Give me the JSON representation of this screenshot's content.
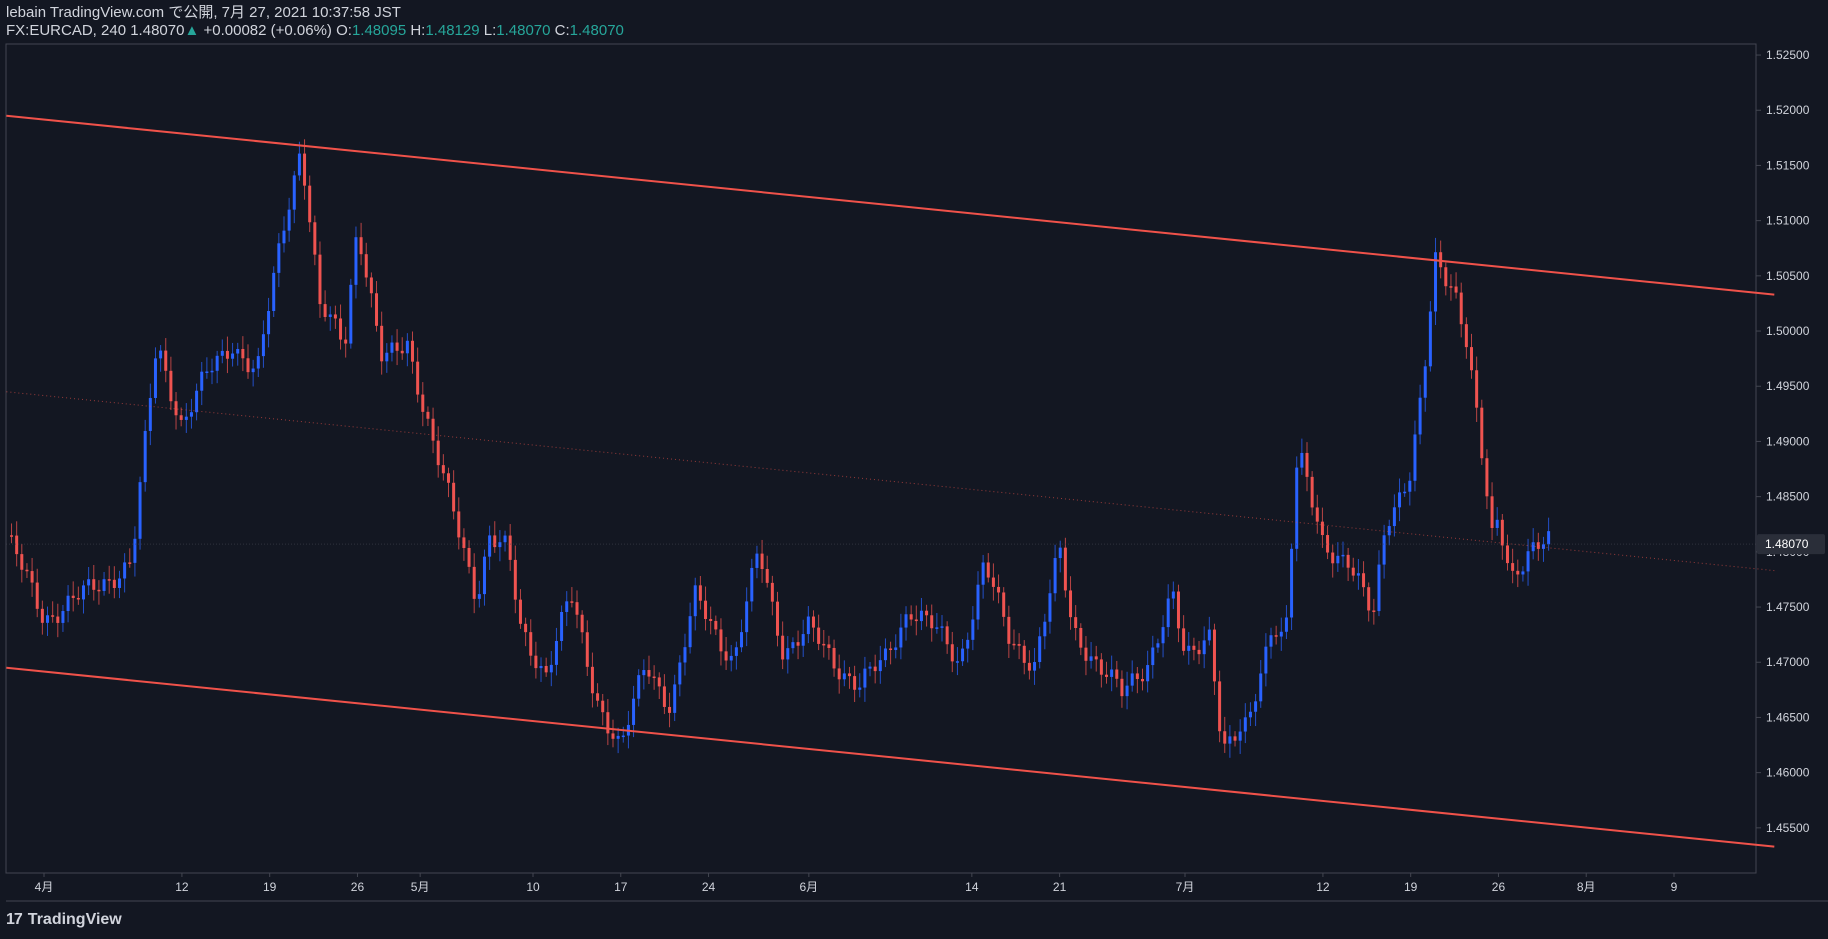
{
  "header": {
    "line1": "lebain TradingView.com で公開, 7月 27, 2021 10:37:58 JST",
    "symbol": "FX:EURCAD, 240",
    "last": "1.48070",
    "change_arrow": "▲",
    "change": "+0.00082 (+0.06%)",
    "o_label": "O:",
    "o": "1.48095",
    "h_label": "H:",
    "h": "1.48129",
    "l_label": "L:",
    "l": "1.48070",
    "c_label": "C:",
    "c": "1.48070"
  },
  "footer": {
    "brand": "TradingView",
    "logo": "17"
  },
  "colors": {
    "bg": "#131722",
    "up": "#2962ff",
    "down": "#ef5350",
    "channel": "#f0524a",
    "axis_text": "#d1d4dc",
    "grid": "#1e222d"
  },
  "chart_data": {
    "type": "candlestick",
    "symbol": "FX:EURCAD",
    "interval": "240",
    "ylim": [
      1.451,
      1.526
    ],
    "y_ticks": [
      "1.52500",
      "1.52000",
      "1.51500",
      "1.51000",
      "1.50500",
      "1.50000",
      "1.49500",
      "1.49000",
      "1.48500",
      "1.48000",
      "1.47500",
      "1.47000",
      "1.46500",
      "1.46000",
      "1.45500"
    ],
    "current_price_label": "1.48070",
    "current_price": 1.4807,
    "x_ticks": [
      "4月",
      "12",
      "19",
      "26",
      "5月",
      "10",
      "17",
      "24",
      "6月",
      "14",
      "21",
      "7月",
      "12",
      "19",
      "26",
      "8月",
      "9"
    ],
    "x_tick_days": [
      0,
      11,
      18,
      25,
      30,
      39,
      46,
      53,
      61,
      74,
      81,
      91,
      102,
      109,
      116,
      123,
      130
    ],
    "close_path": [
      {
        "day": -3,
        "close": 1.4815
      },
      {
        "day": 0,
        "close": 1.474
      },
      {
        "day": 3,
        "close": 1.476
      },
      {
        "day": 7,
        "close": 1.479
      },
      {
        "day": 9,
        "close": 1.499
      },
      {
        "day": 11,
        "close": 1.4915
      },
      {
        "day": 13,
        "close": 1.496
      },
      {
        "day": 15,
        "close": 1.499
      },
      {
        "day": 17,
        "close": 1.496
      },
      {
        "day": 19,
        "close": 1.509
      },
      {
        "day": 20.5,
        "close": 1.517
      },
      {
        "day": 22,
        "close": 1.502
      },
      {
        "day": 24,
        "close": 1.499
      },
      {
        "day": 25,
        "close": 1.51
      },
      {
        "day": 27,
        "close": 1.497
      },
      {
        "day": 29,
        "close": 1.499
      },
      {
        "day": 31,
        "close": 1.49
      },
      {
        "day": 33,
        "close": 1.482
      },
      {
        "day": 34.5,
        "close": 1.476
      },
      {
        "day": 35.5,
        "close": 1.4815
      },
      {
        "day": 37,
        "close": 1.48
      },
      {
        "day": 38,
        "close": 1.473
      },
      {
        "day": 40,
        "close": 1.469
      },
      {
        "day": 42,
        "close": 1.476
      },
      {
        "day": 44,
        "close": 1.467
      },
      {
        "day": 46,
        "close": 1.462
      },
      {
        "day": 48,
        "close": 1.47
      },
      {
        "day": 50,
        "close": 1.466
      },
      {
        "day": 52,
        "close": 1.476
      },
      {
        "day": 55,
        "close": 1.47
      },
      {
        "day": 57,
        "close": 1.48
      },
      {
        "day": 59,
        "close": 1.471
      },
      {
        "day": 61,
        "close": 1.473
      },
      {
        "day": 63,
        "close": 1.47
      },
      {
        "day": 65,
        "close": 1.468
      },
      {
        "day": 67,
        "close": 1.47
      },
      {
        "day": 69,
        "close": 1.475
      },
      {
        "day": 71,
        "close": 1.473
      },
      {
        "day": 73,
        "close": 1.47
      },
      {
        "day": 75,
        "close": 1.479
      },
      {
        "day": 77,
        "close": 1.472
      },
      {
        "day": 79,
        "close": 1.47
      },
      {
        "day": 81,
        "close": 1.48
      },
      {
        "day": 82,
        "close": 1.473
      },
      {
        "day": 84,
        "close": 1.47
      },
      {
        "day": 86,
        "close": 1.467
      },
      {
        "day": 88,
        "close": 1.47
      },
      {
        "day": 90,
        "close": 1.476
      },
      {
        "day": 91,
        "close": 1.47
      },
      {
        "day": 93,
        "close": 1.473
      },
      {
        "day": 94,
        "close": 1.462
      },
      {
        "day": 96,
        "close": 1.464
      },
      {
        "day": 98,
        "close": 1.474
      },
      {
        "day": 99,
        "close": 1.472
      },
      {
        "day": 100,
        "close": 1.489
      },
      {
        "day": 102,
        "close": 1.481
      },
      {
        "day": 104,
        "close": 1.479
      },
      {
        "day": 106,
        "close": 1.474
      },
      {
        "day": 107,
        "close": 1.483
      },
      {
        "day": 109,
        "close": 1.487
      },
      {
        "day": 110,
        "close": 1.495
      },
      {
        "day": 111,
        "close": 1.5065
      },
      {
        "day": 112.5,
        "close": 1.504
      },
      {
        "day": 113.5,
        "close": 1.499
      },
      {
        "day": 114.5,
        "close": 1.49
      },
      {
        "day": 115.5,
        "close": 1.481
      },
      {
        "day": 116,
        "close": 1.483
      },
      {
        "day": 117,
        "close": 1.478
      },
      {
        "day": 118.5,
        "close": 1.48
      },
      {
        "day": 120,
        "close": 1.4807
      }
    ],
    "channel_upper": [
      {
        "day": -3,
        "price": 1.5195
      },
      {
        "day": 138,
        "price": 1.5033
      }
    ],
    "channel_lower": [
      {
        "day": -3,
        "price": 1.4695
      },
      {
        "day": 138,
        "price": 1.4533
      }
    ],
    "channel_mid": [
      {
        "day": -3,
        "price": 1.4945
      },
      {
        "day": 138,
        "price": 1.4783
      }
    ]
  }
}
